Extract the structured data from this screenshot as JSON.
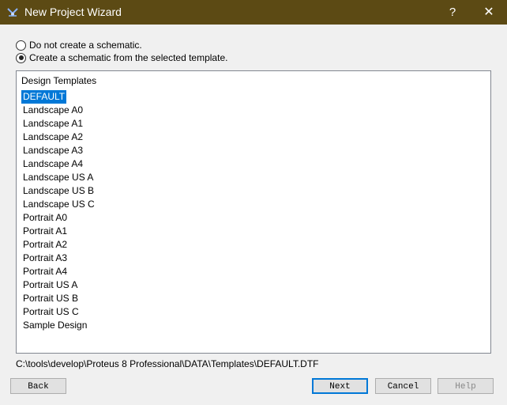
{
  "window": {
    "title": "New Project Wizard",
    "help_glyph": "?",
    "close_glyph": "✕",
    "titlebar_color": "#5c4a14"
  },
  "options": {
    "no_schematic": "Do not create a schematic.",
    "from_template": "Create a schematic from the selected template.",
    "selected": "from_template"
  },
  "templates": {
    "header": "Design Templates",
    "selected": "DEFAULT",
    "items": [
      "DEFAULT",
      "Landscape A0",
      "Landscape A1",
      "Landscape A2",
      "Landscape A3",
      "Landscape A4",
      "Landscape US A",
      "Landscape US B",
      "Landscape US C",
      "Portrait A0",
      "Portrait A1",
      "Portrait A2",
      "Portrait A3",
      "Portrait A4",
      "Portrait US A",
      "Portrait US B",
      "Portrait US C",
      "Sample Design"
    ]
  },
  "template_path": "C:\\tools\\develop\\Proteus 8 Professional\\DATA\\Templates\\DEFAULT.DTF",
  "buttons": {
    "back": "Back",
    "next": "Next",
    "cancel": "Cancel",
    "help": "Help"
  },
  "colors": {
    "selection": "#0078d7"
  }
}
